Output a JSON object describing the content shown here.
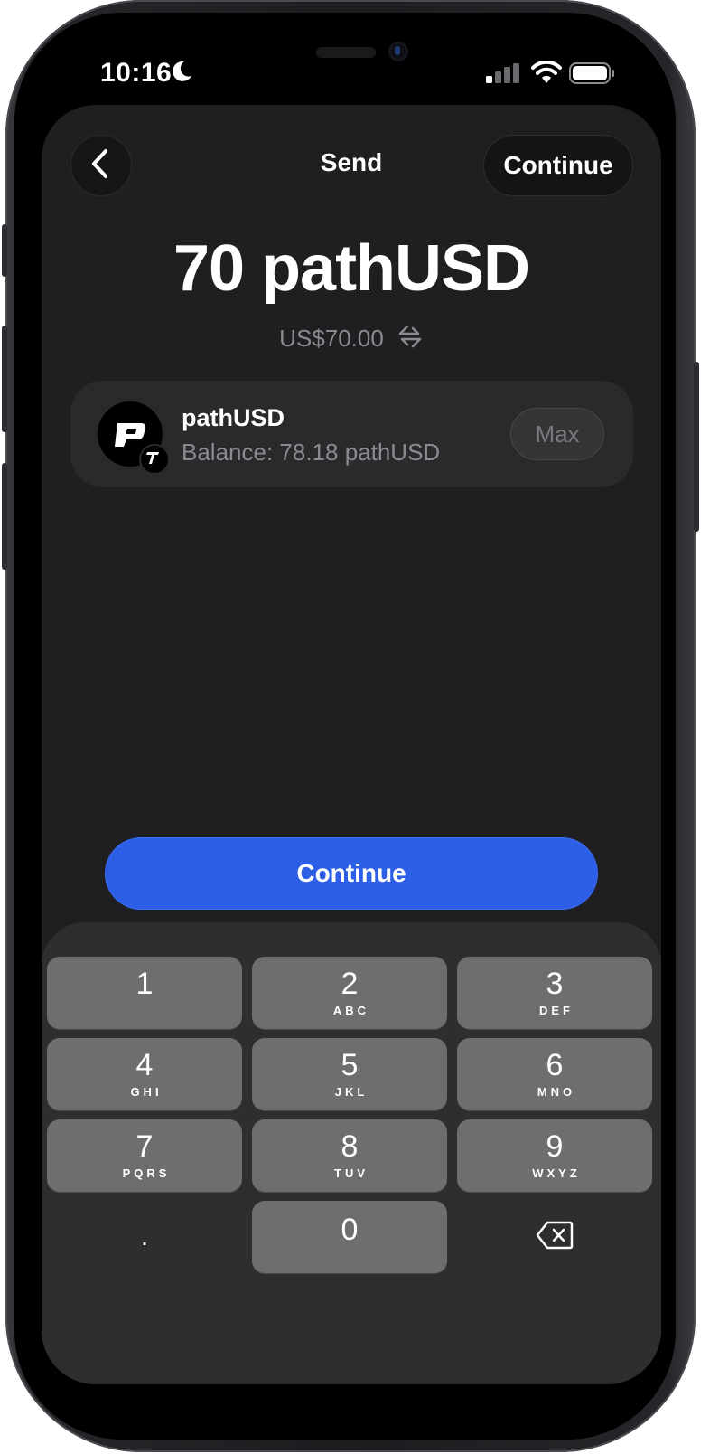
{
  "status_bar": {
    "time": "10:16",
    "icons": [
      "moon-icon",
      "cellular-signal-icon",
      "wifi-icon",
      "battery-icon"
    ]
  },
  "header": {
    "back_icon": "chevron-left-icon",
    "title": "Send",
    "continue_label": "Continue"
  },
  "amount": {
    "value": "70",
    "token": "pathUSD",
    "fiat": "US$70.00",
    "swap_icon": "swap-arrows-icon"
  },
  "token_card": {
    "name": "pathUSD",
    "balance": "Balance: 78.18 pathUSD",
    "max_label": "Max",
    "logo_icon": "pathusd-logo-icon",
    "badge_icon": "tempo-t-badge-icon"
  },
  "continue_button": {
    "label": "Continue"
  },
  "keypad": {
    "keys": [
      {
        "num": "1",
        "letters": ""
      },
      {
        "num": "2",
        "letters": "ABC"
      },
      {
        "num": "3",
        "letters": "DEF"
      },
      {
        "num": "4",
        "letters": "GHI"
      },
      {
        "num": "5",
        "letters": "JKL"
      },
      {
        "num": "6",
        "letters": "MNO"
      },
      {
        "num": "7",
        "letters": "PQRS"
      },
      {
        "num": "8",
        "letters": "TUV"
      },
      {
        "num": "9",
        "letters": "WXYZ"
      }
    ],
    "decimal": ".",
    "zero": "0",
    "delete_icon": "backspace-icon"
  },
  "colors": {
    "accent": "#2c5ee6",
    "sheet_bg": "#1f1f21",
    "key_bg": "#6e6e6e"
  }
}
